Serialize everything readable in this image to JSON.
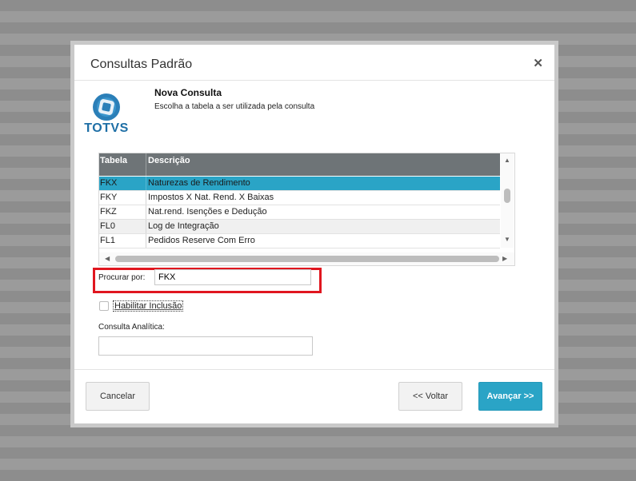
{
  "dialog": {
    "title": "Consultas Padrão",
    "close_icon": "close-icon"
  },
  "logo": {
    "text": "TOTVS"
  },
  "header": {
    "title": "Nova Consulta",
    "subtitle": "Escolha a tabela a ser utilizada pela consulta"
  },
  "grid": {
    "columns": [
      "Tabela",
      "Descrição"
    ],
    "rows": [
      {
        "tabela": "FKX",
        "descricao": "Naturezas de Rendimento",
        "selected": true
      },
      {
        "tabela": "FKY",
        "descricao": "Impostos X Nat. Rend. X Baixas"
      },
      {
        "tabela": "FKZ",
        "descricao": "Nat.rend. Isenções e Dedução"
      },
      {
        "tabela": "FL0",
        "descricao": "Log de Integração"
      },
      {
        "tabela": "FL1",
        "descricao": "Pedidos Reserve Com Erro"
      }
    ]
  },
  "search": {
    "label": "Procurar por:",
    "value": "FKX"
  },
  "habilitar": {
    "label": "Habilitar Inclusão",
    "checked": false
  },
  "analitica": {
    "label": "Consulta Analítica:",
    "value": ""
  },
  "buttons": {
    "cancel": "Cancelar",
    "back": "<< Voltar",
    "next": "Avançar >>"
  },
  "colors": {
    "accent": "#2aa4c6",
    "grid_header": "#6e7477",
    "highlight_border": "#e0161f"
  }
}
